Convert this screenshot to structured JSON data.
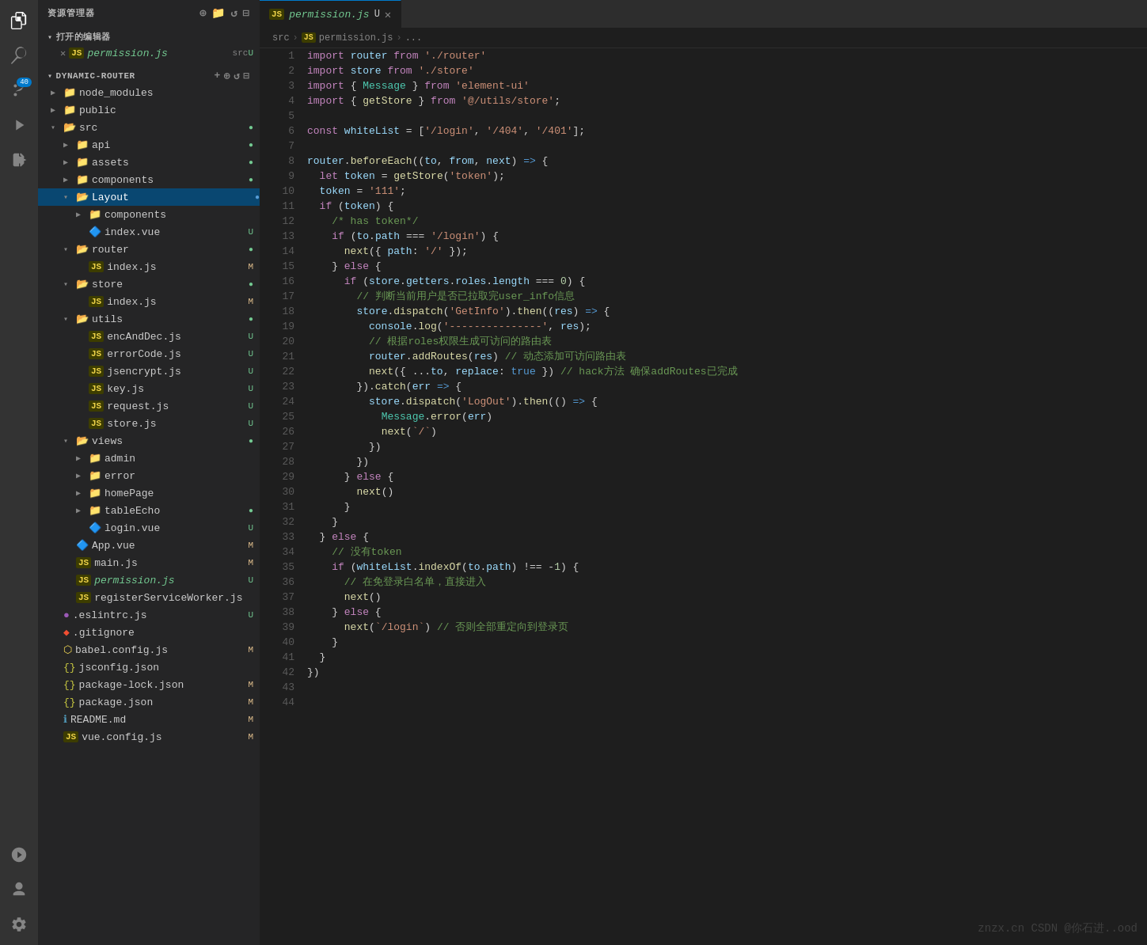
{
  "activityBar": {
    "icons": [
      {
        "name": "files-icon",
        "symbol": "⎗",
        "active": true,
        "badge": null
      },
      {
        "name": "search-icon",
        "symbol": "⌕",
        "active": false,
        "badge": null
      },
      {
        "name": "source-control-icon",
        "symbol": "⑂",
        "active": false,
        "badge": "40"
      },
      {
        "name": "run-icon",
        "symbol": "▷",
        "active": false,
        "badge": null
      },
      {
        "name": "extensions-icon",
        "symbol": "⊞",
        "active": false,
        "badge": null
      },
      {
        "name": "remote-icon",
        "symbol": "⤳",
        "active": false,
        "badge": null
      }
    ]
  },
  "sidebar": {
    "header": "资源管理器",
    "openEditors": {
      "title": "打开的编辑器",
      "items": [
        {
          "name": "permission.js",
          "type": "js",
          "path": "src",
          "modified": "U"
        }
      ]
    },
    "explorer": {
      "rootName": "DYNAMIC-ROUTER",
      "tree": []
    }
  },
  "tab": {
    "filename": "permission.js",
    "type": "JS",
    "modified": "U",
    "path": [
      "src",
      "permission.js",
      "..."
    ]
  },
  "watermark": "znzx.cn  CSDN @你石进..ood"
}
